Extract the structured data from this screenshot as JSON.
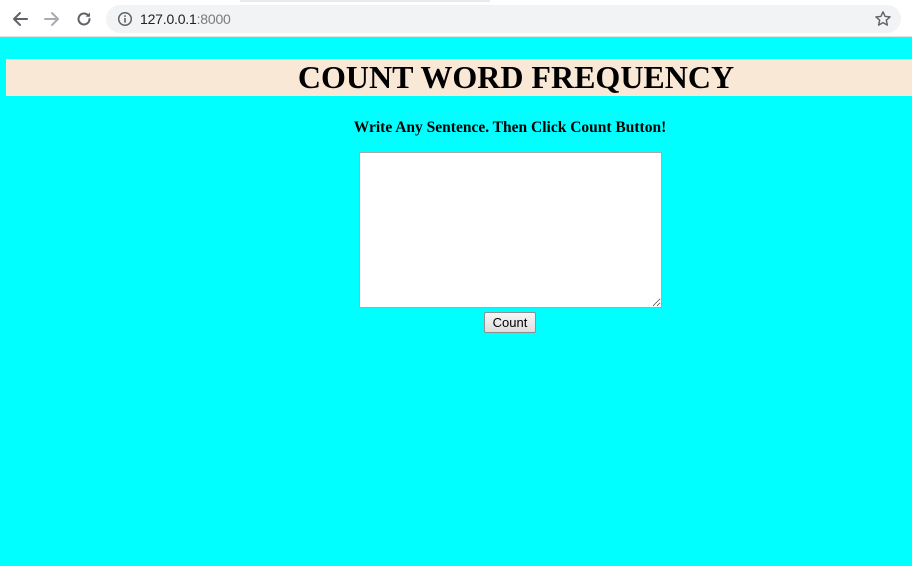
{
  "browser": {
    "url_host": "127.0.0.1",
    "url_port": ":8000",
    "icons": {
      "back": "back-arrow-icon",
      "forward": "forward-arrow-icon",
      "reload": "reload-icon",
      "info": "info-icon",
      "bookmark": "star-icon"
    }
  },
  "page": {
    "background_color": "#00ffff",
    "header_color": "#fae8d7",
    "title": "COUNT WORD FREQUENCY",
    "instruction": "Write Any Sentence. Then Click Count Button!",
    "sentence_input": {
      "value": "",
      "placeholder": ""
    },
    "count_button_label": "Count"
  }
}
